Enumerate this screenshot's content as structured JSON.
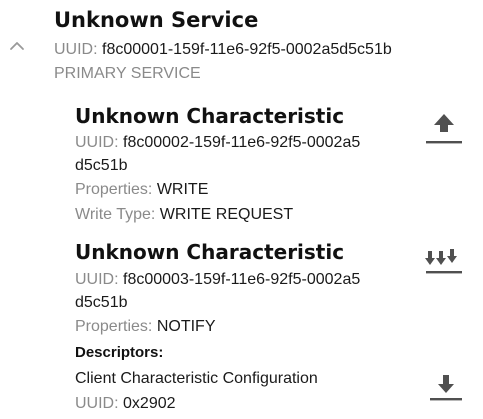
{
  "service": {
    "title": "Unknown Service",
    "uuid_label": "UUID:",
    "uuid": "f8c00001-159f-11e6-92f5-0002a5d5c51b",
    "type": "PRIMARY SERVICE",
    "expanded": true
  },
  "characteristics": [
    {
      "title": "Unknown Characteristic",
      "uuid_label": "UUID:",
      "uuid_line1": "f8c00002-159f-11e6-92f5-0002a5",
      "uuid_line2": "d5c51b",
      "properties_label": "Properties:",
      "properties": "WRITE",
      "write_type_label": "Write Type:",
      "write_type": "WRITE REQUEST",
      "action_icon": "upload-icon"
    },
    {
      "title": "Unknown Characteristic",
      "uuid_label": "UUID:",
      "uuid_line1": "f8c00003-159f-11e6-92f5-0002a5",
      "uuid_line2": "d5c51b",
      "properties_label": "Properties:",
      "properties": "NOTIFY",
      "action_icon": "enable-notifications-icon",
      "descriptors_label": "Descriptors:",
      "descriptors": [
        {
          "name": "Client Characteristic Configuration",
          "uuid_label": "UUID:",
          "uuid": "0x2902",
          "action_icon": "download-icon"
        }
      ]
    }
  ],
  "colors": {
    "text": "#111111",
    "muted": "#8a8a8a",
    "icon": "#505050",
    "background": "#ffffff"
  }
}
